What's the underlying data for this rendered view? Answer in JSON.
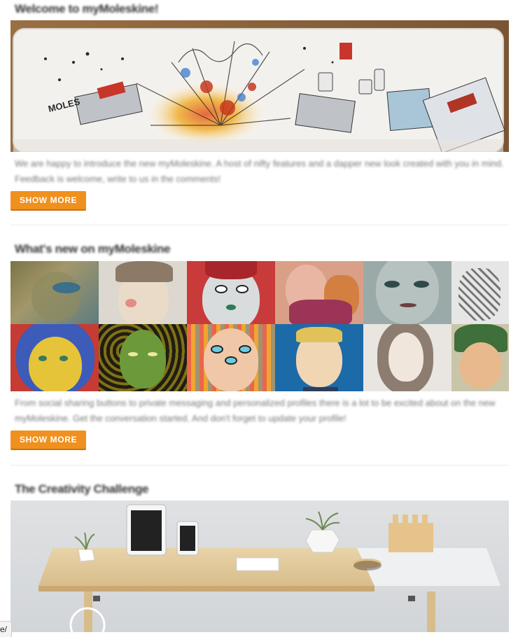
{
  "sections": [
    {
      "title": "Welcome to myMoleskine!",
      "description": "We are happy to introduce the new myMoleskine. A host of nifty features and a dapper new look created with you in mind. Feedback is welcome, write to us in the comments!",
      "button_label": "SHOW MORE"
    },
    {
      "title": "What's new on myMoleskine",
      "description": "From social sharing buttons to private messaging and personalized profiles there is a lot to be excited about on the new myMoleskine. Get the conversation started. And don't forget to update your profile!",
      "button_label": "SHOW MORE"
    },
    {
      "title": "The Creativity Challenge"
    }
  ],
  "status_bar": {
    "text": "e/"
  },
  "colors": {
    "accent": "#f0901e",
    "accent_dark": "#c8720f",
    "divider": "#ececec"
  }
}
